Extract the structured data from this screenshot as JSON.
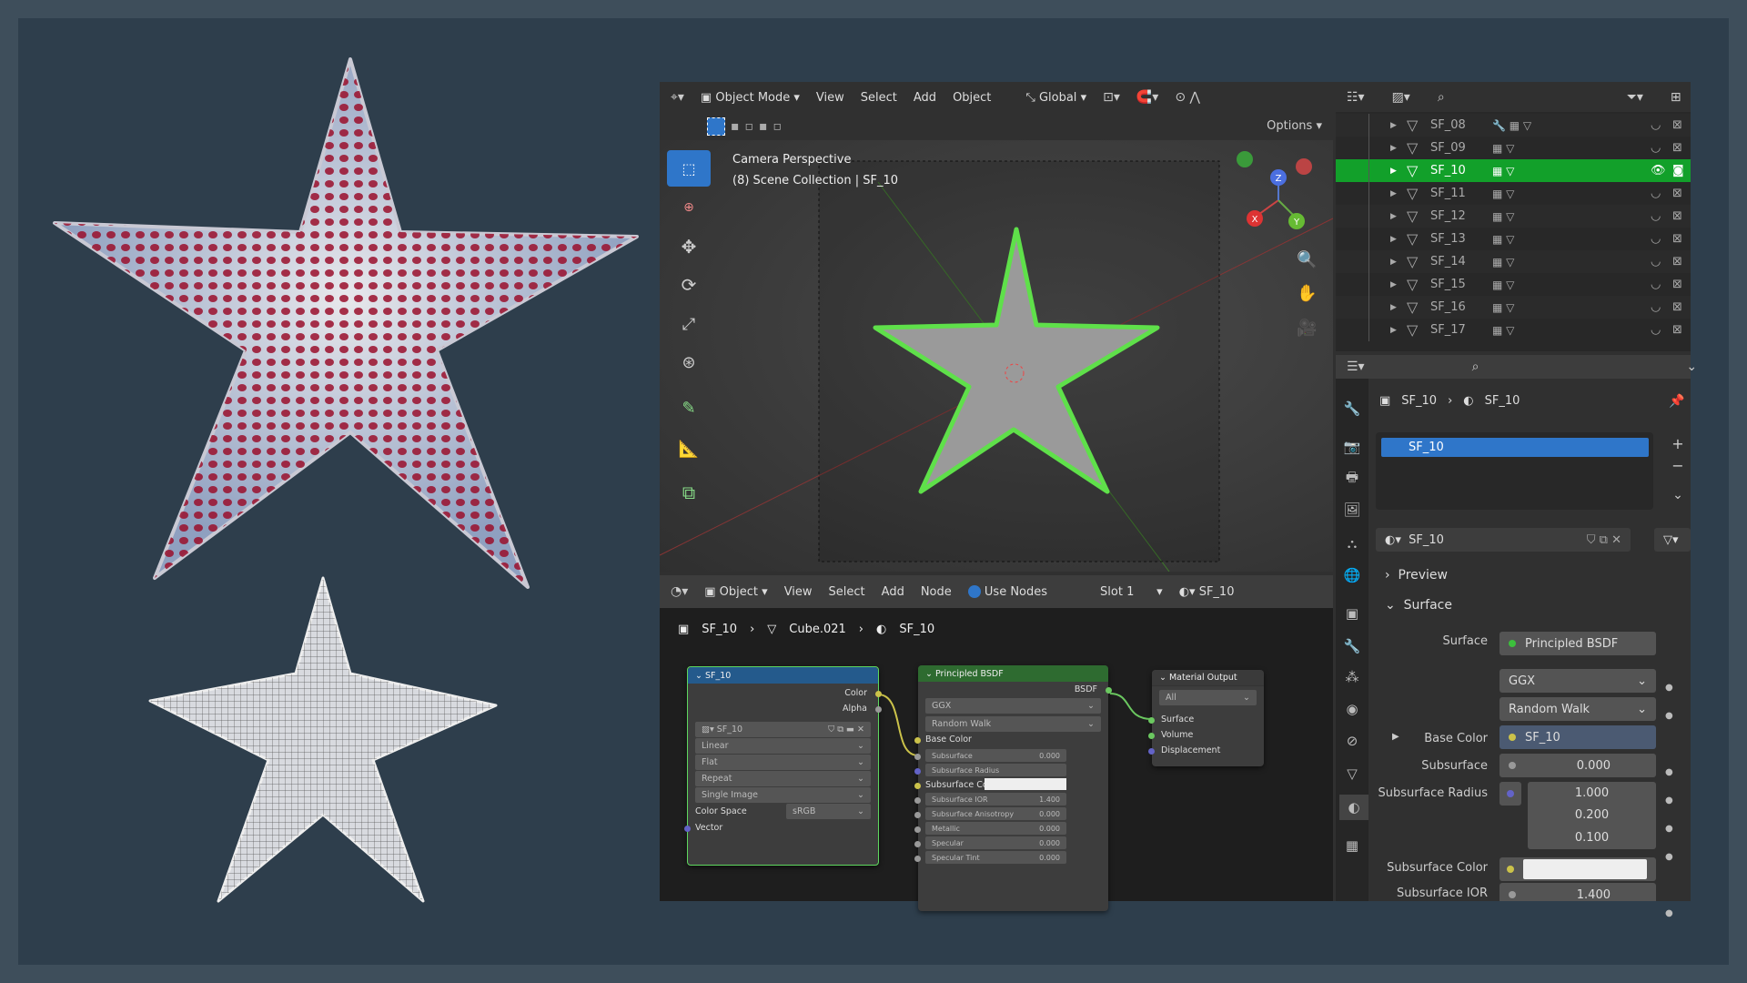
{
  "viewport": {
    "mode": "Object Mode",
    "menus": [
      "View",
      "Select",
      "Add",
      "Object"
    ],
    "transform": "Global",
    "options": "Options",
    "overlay_title": "Camera Perspective",
    "overlay_sub": "(8) Scene Collection | SF_10",
    "axes": {
      "x": "X",
      "y": "Y",
      "z": "Z"
    }
  },
  "outliner": {
    "rows": [
      {
        "name": "SF_08"
      },
      {
        "name": "SF_09"
      },
      {
        "name": "SF_10",
        "selected": true
      },
      {
        "name": "SF_11"
      },
      {
        "name": "SF_12"
      },
      {
        "name": "SF_13"
      },
      {
        "name": "SF_14"
      },
      {
        "name": "SF_15"
      },
      {
        "name": "SF_16"
      },
      {
        "name": "SF_17"
      }
    ]
  },
  "properties": {
    "breadcrumb": [
      "SF_10",
      "SF_10"
    ],
    "slot_name": "SF_10",
    "material_name": "SF_10",
    "panels": {
      "preview": "Preview",
      "surface": "Surface"
    },
    "fields": {
      "surface_label": "Surface",
      "surface_value": "Principled BSDF",
      "distribution": "GGX",
      "subsurface_method": "Random Walk",
      "base_color_label": "Base Color",
      "base_color_value": "SF_10",
      "subsurface_label": "Subsurface",
      "subsurface_value": "0.000",
      "radius_label": "Subsurface Radius",
      "radius": [
        "1.000",
        "0.200",
        "0.100"
      ],
      "sss_color_label": "Subsurface Color",
      "ior_label": "Subsurface IOR",
      "ior_value": "1.400"
    }
  },
  "node_editor": {
    "object": "Object",
    "menus": [
      "View",
      "Select",
      "Add",
      "Node"
    ],
    "use_nodes": "Use Nodes",
    "slot": "Slot 1",
    "material": "SF_10",
    "breadcrumb": [
      "SF_10",
      "Cube.021",
      "SF_10"
    ],
    "image_node": {
      "title": "SF_10",
      "out_color": "Color",
      "out_alpha": "Alpha",
      "image": "SF_10",
      "interp": "Linear",
      "proj": "Flat",
      "ext": "Repeat",
      "source": "Single Image",
      "cs_label": "Color Space",
      "cs_value": "sRGB",
      "vector": "Vector"
    },
    "bsdf_node": {
      "title": "Principled BSDF",
      "out": "BSDF",
      "dist": "GGX",
      "sss": "Random Walk",
      "base_color": "Base Color",
      "rows": [
        {
          "l": "Subsurface",
          "v": "0.000"
        },
        {
          "l": "Subsurface Radius",
          "v": ""
        },
        {
          "l": "Subsurface Color",
          "v": ""
        },
        {
          "l": "Subsurface IOR",
          "v": "1.400"
        },
        {
          "l": "Subsurface Anisotropy",
          "v": "0.000"
        },
        {
          "l": "Metallic",
          "v": "0.000"
        },
        {
          "l": "Specular",
          "v": "0.000"
        },
        {
          "l": "Specular Tint",
          "v": "0.000"
        }
      ]
    },
    "output_node": {
      "title": "Material Output",
      "target": "All",
      "inputs": [
        "Surface",
        "Volume",
        "Displacement"
      ]
    }
  },
  "colors": {
    "selected_row": "#12a02a",
    "active_blue": "#2f76c9",
    "node_image_header": "#245a8c",
    "node_shader_header": "#2e6b30"
  }
}
